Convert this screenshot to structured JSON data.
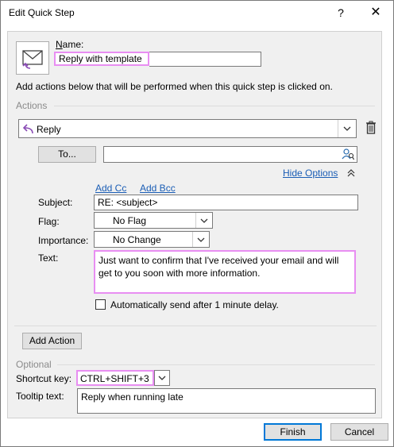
{
  "dialog": {
    "title": "Edit Quick Step",
    "help_label": "?",
    "close_label": "✕"
  },
  "name": {
    "label": "Name:",
    "value": "Reply with template"
  },
  "description": "Add actions below that will be performed when this quick step is clicked on.",
  "actions_heading": "Actions",
  "action": {
    "selected": "Reply",
    "to_button": "To...",
    "to_value": "",
    "hide_options": "Hide Options",
    "add_cc": "Add Cc",
    "add_bcc": "Add Bcc",
    "subject_label": "Subject:",
    "subject_value": "RE: <subject>",
    "flag_label": "Flag:",
    "flag_value": "No Flag",
    "importance_label": "Importance:",
    "importance_value": "No Change",
    "text_label": "Text:",
    "text_value": "Just want to confirm that I've received your email and will get to you soon with more information.",
    "auto_send_label": "Automatically send after 1 minute delay.",
    "auto_send_checked": false
  },
  "add_action_button": "Add Action",
  "optional_heading": "Optional",
  "shortcut": {
    "label": "Shortcut key:",
    "value": "CTRL+SHIFT+3"
  },
  "tooltip": {
    "label": "Tooltip text:",
    "value": "Reply when running late"
  },
  "footer": {
    "finish": "Finish",
    "cancel": "Cancel"
  },
  "colors": {
    "highlight": "#e88ef2",
    "link": "#1a5db5",
    "finish_border": "#0078d7"
  }
}
